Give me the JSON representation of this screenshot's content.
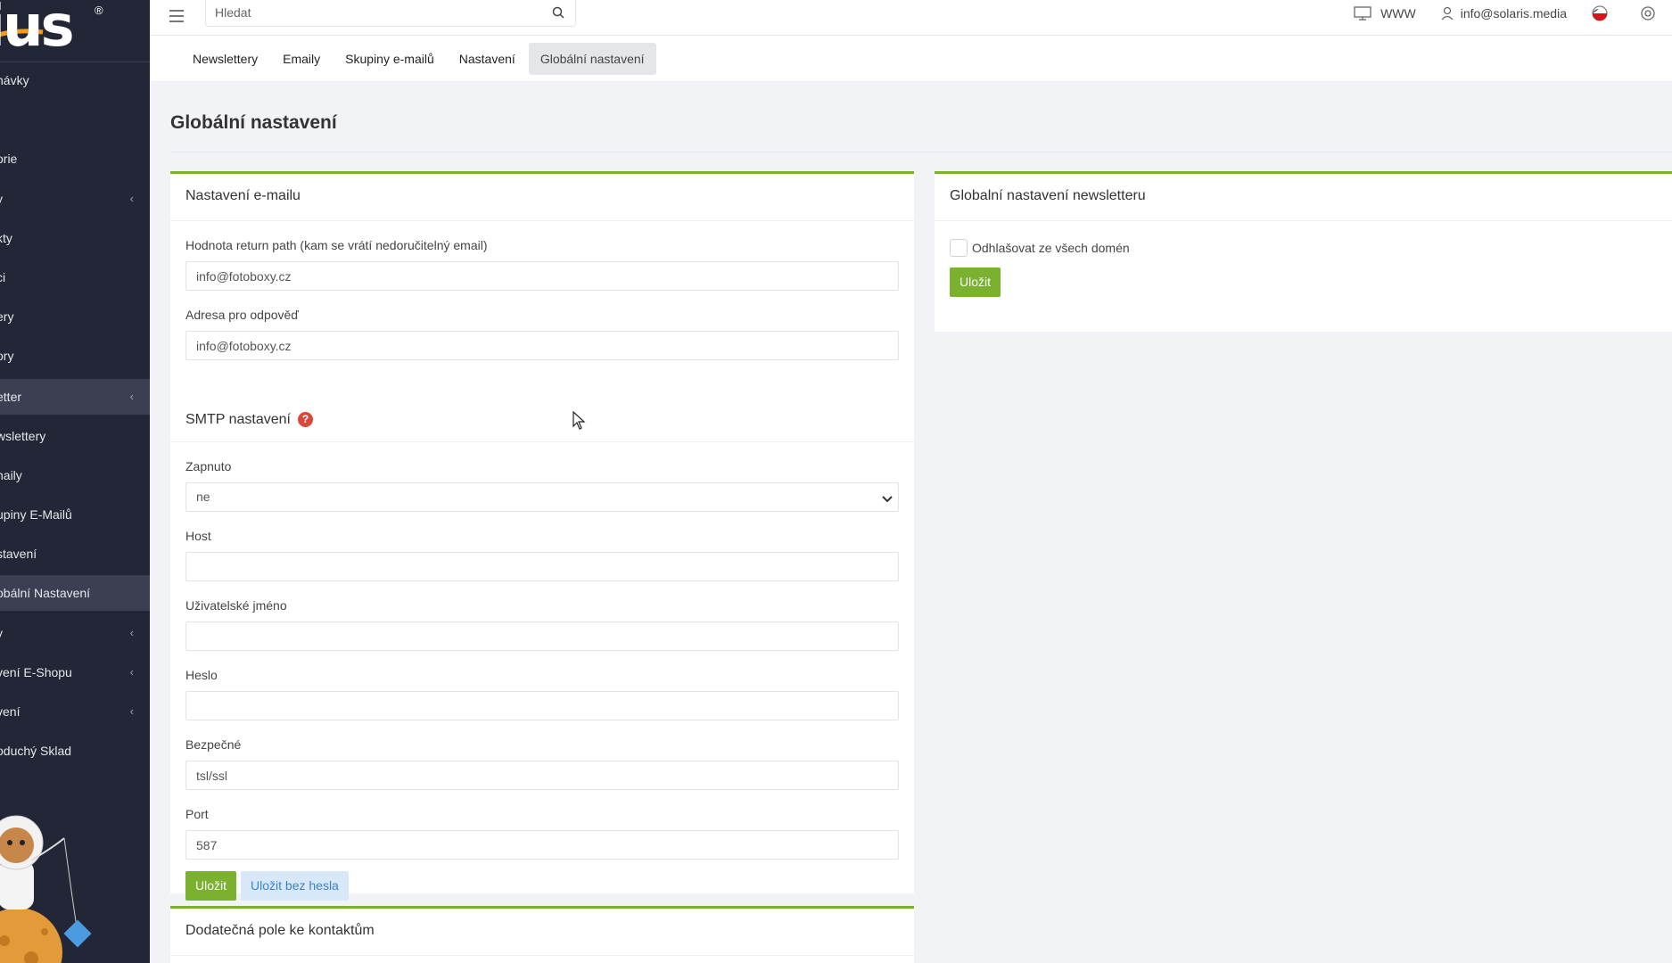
{
  "brand": {
    "logo_text": "ius",
    "reg_mark": "®"
  },
  "sidebar": {
    "items": [
      {
        "label": "návky",
        "chevron": false,
        "active": false
      },
      {
        "label": "orie",
        "chevron": false,
        "active": false
      },
      {
        "label": "y",
        "chevron": true,
        "active": false
      },
      {
        "label": "kty",
        "chevron": false,
        "active": false
      },
      {
        "label": "ci",
        "chevron": false,
        "active": false
      },
      {
        "label": "ery",
        "chevron": false,
        "active": false
      },
      {
        "label": "ory",
        "chevron": false,
        "active": false
      },
      {
        "label": "etter",
        "chevron": true,
        "active": true
      },
      {
        "label": "wslettery",
        "chevron": false,
        "active": false
      },
      {
        "label": "naily",
        "chevron": false,
        "active": false
      },
      {
        "label": "upiny E-Mailů",
        "chevron": false,
        "active": false
      },
      {
        "label": "stavení",
        "chevron": false,
        "active": false
      },
      {
        "label": "obální Nastavení",
        "chevron": false,
        "active": true
      },
      {
        "label": "y",
        "chevron": true,
        "active": false
      },
      {
        "label": "vení E-Shopu",
        "chevron": true,
        "active": false
      },
      {
        "label": "vení",
        "chevron": true,
        "active": false
      },
      {
        "label": "oduchý Sklad",
        "chevron": false,
        "active": false
      }
    ],
    "chevron_glyph": "‹"
  },
  "topbar": {
    "search_placeholder": "Hledat",
    "www_label": "WWW",
    "user_email": "info@solaris.media"
  },
  "tabs": [
    {
      "label": "Newslettery",
      "active": false
    },
    {
      "label": "Emaily",
      "active": false
    },
    {
      "label": "Skupiny e-mailů",
      "active": false
    },
    {
      "label": "Nastavení",
      "active": false
    },
    {
      "label": "Globální nastavení",
      "active": true
    }
  ],
  "page": {
    "title": "Globální nastavení"
  },
  "email_panel": {
    "title": "Nastavení e-mailu",
    "return_path_label": "Hodnota return path (kam se vrátí nedoručitelný email)",
    "return_path_value": "info@fotoboxy.cz",
    "reply_label": "Adresa pro odpověď",
    "reply_value": "info@fotoboxy.cz",
    "smtp_title": "SMTP nastavení",
    "smtp_help": "?",
    "enabled_label": "Zapnuto",
    "enabled_value": "ne",
    "host_label": "Host",
    "host_value": "",
    "user_label": "Uživatelské jméno",
    "user_value": "",
    "password_label": "Heslo",
    "password_value": "",
    "secure_label": "Bezpečné",
    "secure_value": "tsl/ssl",
    "port_label": "Port",
    "port_value": "587",
    "save_label": "Uložit",
    "save_no_password_label": "Uložit bez hesla"
  },
  "newsletter_panel": {
    "title": "Globalní nastavení newsletteru",
    "unsubscribe_label": "Odhlašovat ze všech domén",
    "save_label": "Uložit"
  },
  "contacts_panel": {
    "title": "Dodatečná pole ke kontaktům"
  },
  "colors": {
    "accent_green": "#7ab12e",
    "sidebar_bg": "#222636",
    "help_red": "#d9493b"
  },
  "icons": [
    "hamburger-icon",
    "search-icon",
    "monitor-icon",
    "user-icon",
    "flag-icon",
    "power-icon",
    "help-icon",
    "chevron-down-icon"
  ]
}
